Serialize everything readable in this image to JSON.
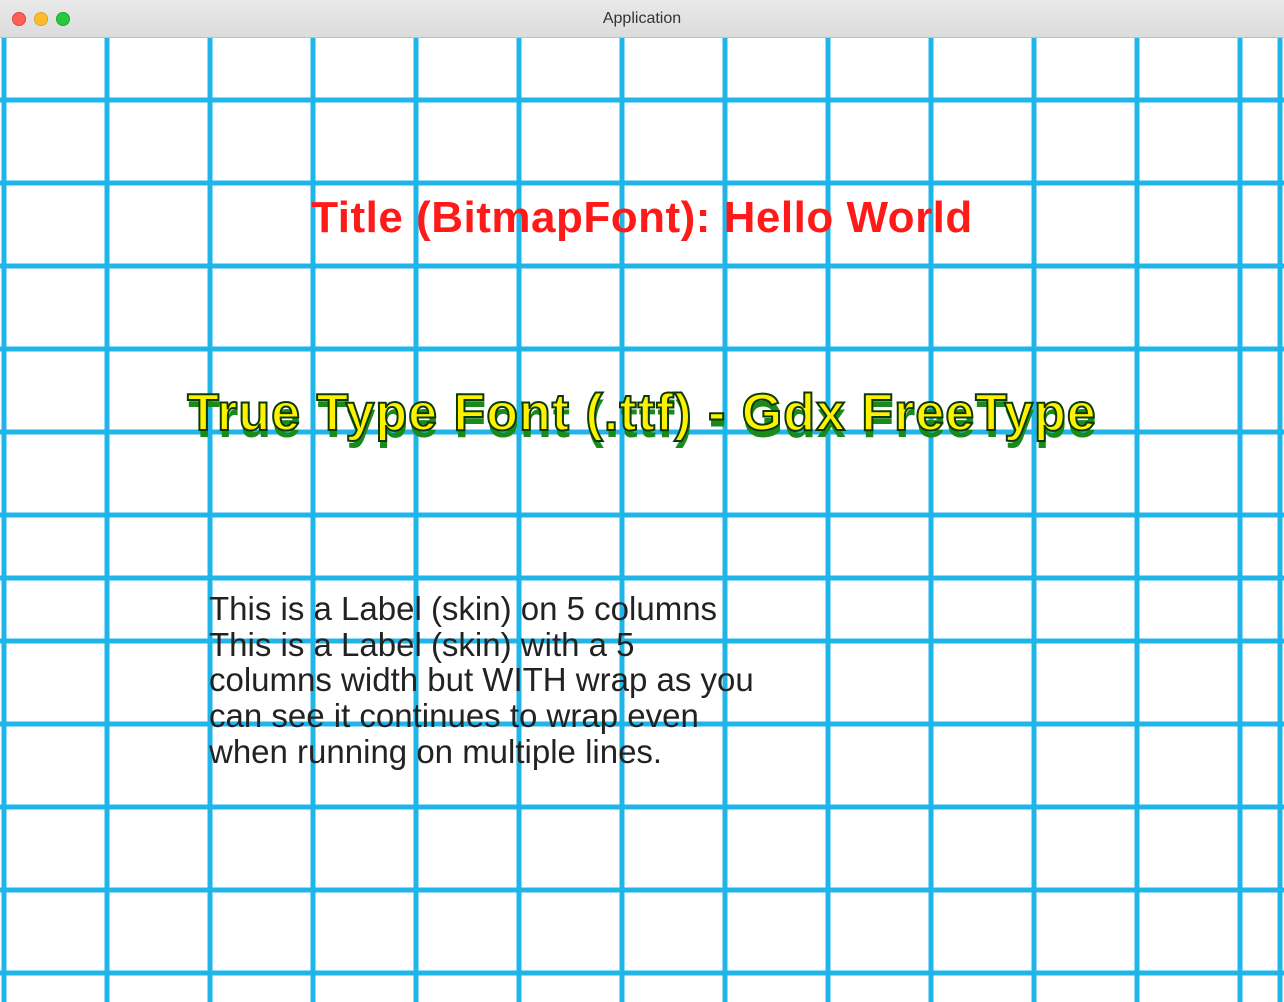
{
  "window": {
    "title": "Application"
  },
  "content": {
    "title_text": "Title (BitmapFont): Hello World",
    "ttf_text": "True Type Font (.ttf) - Gdx FreeType",
    "label_line1": "This is a Label (skin) on  5 columns",
    "label_wrap": "This is a Label (skin) with a 5 columns width but WITH wrap as you can see it continues to wrap even when running on multiple lines."
  },
  "colors": {
    "grid": "#1fb5e8",
    "title": "#ff1a1a",
    "ttf_fill": "#fff200",
    "ttf_shadow": "#1a8a1a"
  }
}
